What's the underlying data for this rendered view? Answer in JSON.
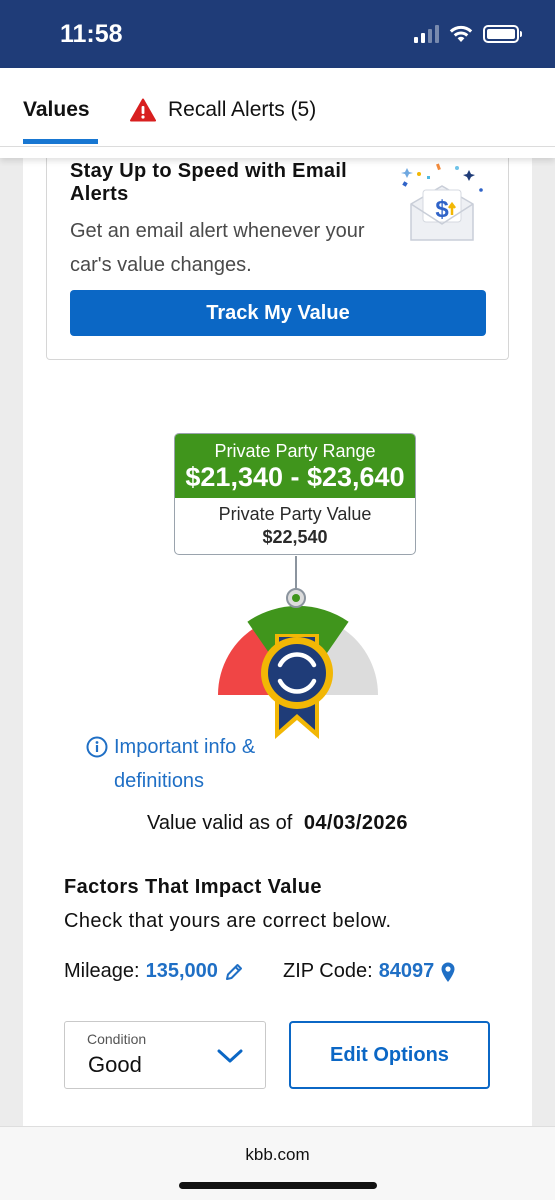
{
  "status_bar": {
    "time": "11:58"
  },
  "tabs": {
    "values_label": "Values",
    "recall_label": "Recall Alerts (5)"
  },
  "email_alert": {
    "title": "Stay Up to Speed with Email Alerts",
    "description": "Get an email alert whenever your car's value changes.",
    "button_label": "Track My Value",
    "icon": "envelope-dollar-icon"
  },
  "valuation": {
    "range_label": "Private Party Range",
    "range_value": "$21,340 - $23,640",
    "value_label": "Private Party Value",
    "value": "$22,540",
    "gauge_icon": "kbb-ribbon-icon",
    "colors": {
      "range_green": "#40951c",
      "low_red": "#f04545",
      "high_gray": "#dcdcdc",
      "ribbon_navy": "#1f3c78",
      "ribbon_gold": "#f2b705"
    }
  },
  "info": {
    "link_text": "Important info & definitions",
    "icon": "info-circle-icon"
  },
  "validity": {
    "label": "Value valid as of",
    "date": "04/03/2026"
  },
  "factors": {
    "title": "Factors That Impact Value",
    "subtitle": "Check that yours are correct below.",
    "mileage_label": "Mileage:",
    "mileage_value": "135,000",
    "zip_label": "ZIP Code:",
    "zip_value": "84097",
    "condition_label": "Condition",
    "condition_value": "Good",
    "edit_options_label": "Edit Options"
  },
  "browser": {
    "url": "kbb.com"
  },
  "theme": {
    "brand_navy": "#1f3c78",
    "accent_blue": "#0b67c5",
    "link_blue": "#1f6fc5"
  }
}
